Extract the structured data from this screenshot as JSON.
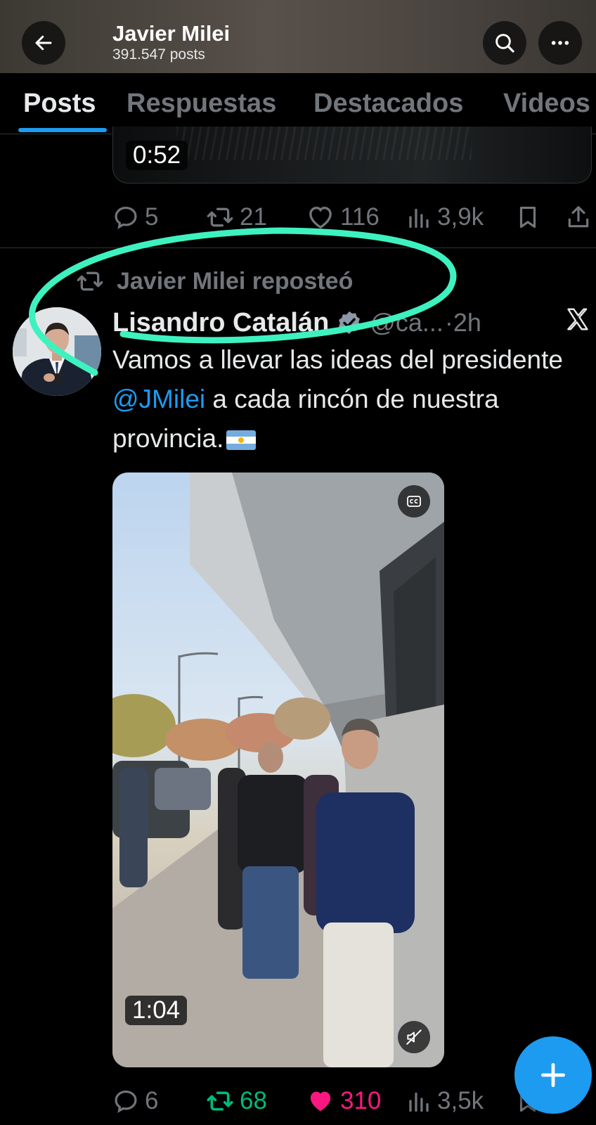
{
  "header": {
    "title": "Javier Milei",
    "subtitle": "391.547 posts"
  },
  "tabs": [
    {
      "label": "Posts",
      "active": true
    },
    {
      "label": "Respuestas",
      "active": false
    },
    {
      "label": "Destacados",
      "active": false
    },
    {
      "label": "Videos",
      "active": false
    }
  ],
  "previous_post": {
    "video_duration": "0:52",
    "actions": {
      "replies": "5",
      "reposts": "21",
      "likes": "116",
      "views": "3,9k"
    }
  },
  "post": {
    "repost_label": "Javier Milei reposteó",
    "author_name": "Lisandro Catalán",
    "handle": "@ca...",
    "time": "·2h",
    "text_part1": "Vamos a llevar las ideas del presidente ",
    "mention": "@JMilei",
    "text_part2": " a cada rincón de nuestra provincia.",
    "video_duration": "1:04",
    "actions": {
      "replies": "6",
      "reposts": "68",
      "likes": "310",
      "views": "3,5k"
    }
  },
  "colors": {
    "accent": "#1d9bf0",
    "repost_active": "#00ba7c",
    "like_active": "#f91880",
    "muted_text": "#71767b",
    "annotation": "#3ef2c0"
  },
  "icons": [
    "back-arrow-icon",
    "search-icon",
    "more-icon",
    "reply-icon",
    "repost-icon",
    "like-icon",
    "views-icon",
    "bookmark-icon",
    "share-icon",
    "verified-badge-icon",
    "x-logo-icon",
    "cc-icon",
    "mute-icon",
    "plus-icon"
  ]
}
